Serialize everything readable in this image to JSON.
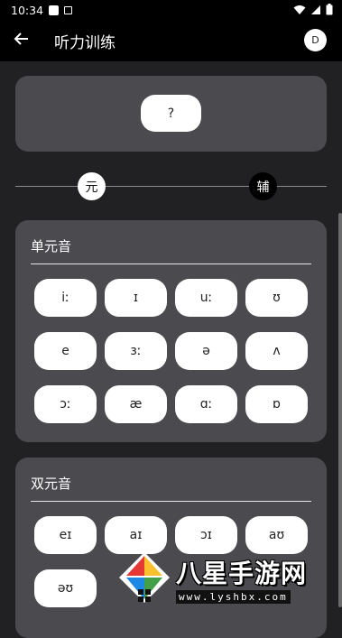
{
  "status_bar": {
    "time": "10:34"
  },
  "app_bar": {
    "title": "听力训练",
    "avatar_letter": "D"
  },
  "question": {
    "label": "?"
  },
  "selector": {
    "vowel_label": "元",
    "consonant_label": "辅",
    "selected": "元"
  },
  "monophthongs": {
    "title": "单元音",
    "symbols": [
      "iː",
      "ɪ",
      "uː",
      "ʊ",
      "e",
      "ɜː",
      "ə",
      "ʌ",
      "ɔː",
      "æ",
      "ɑː",
      "ɒ"
    ]
  },
  "diphthongs": {
    "title": "双元音",
    "symbols": [
      "eɪ",
      "aɪ",
      "ɔɪ",
      "aʊ",
      "əʊ"
    ]
  },
  "watermark": {
    "text": "八星手游网",
    "url": "www.lyshbx.com"
  }
}
